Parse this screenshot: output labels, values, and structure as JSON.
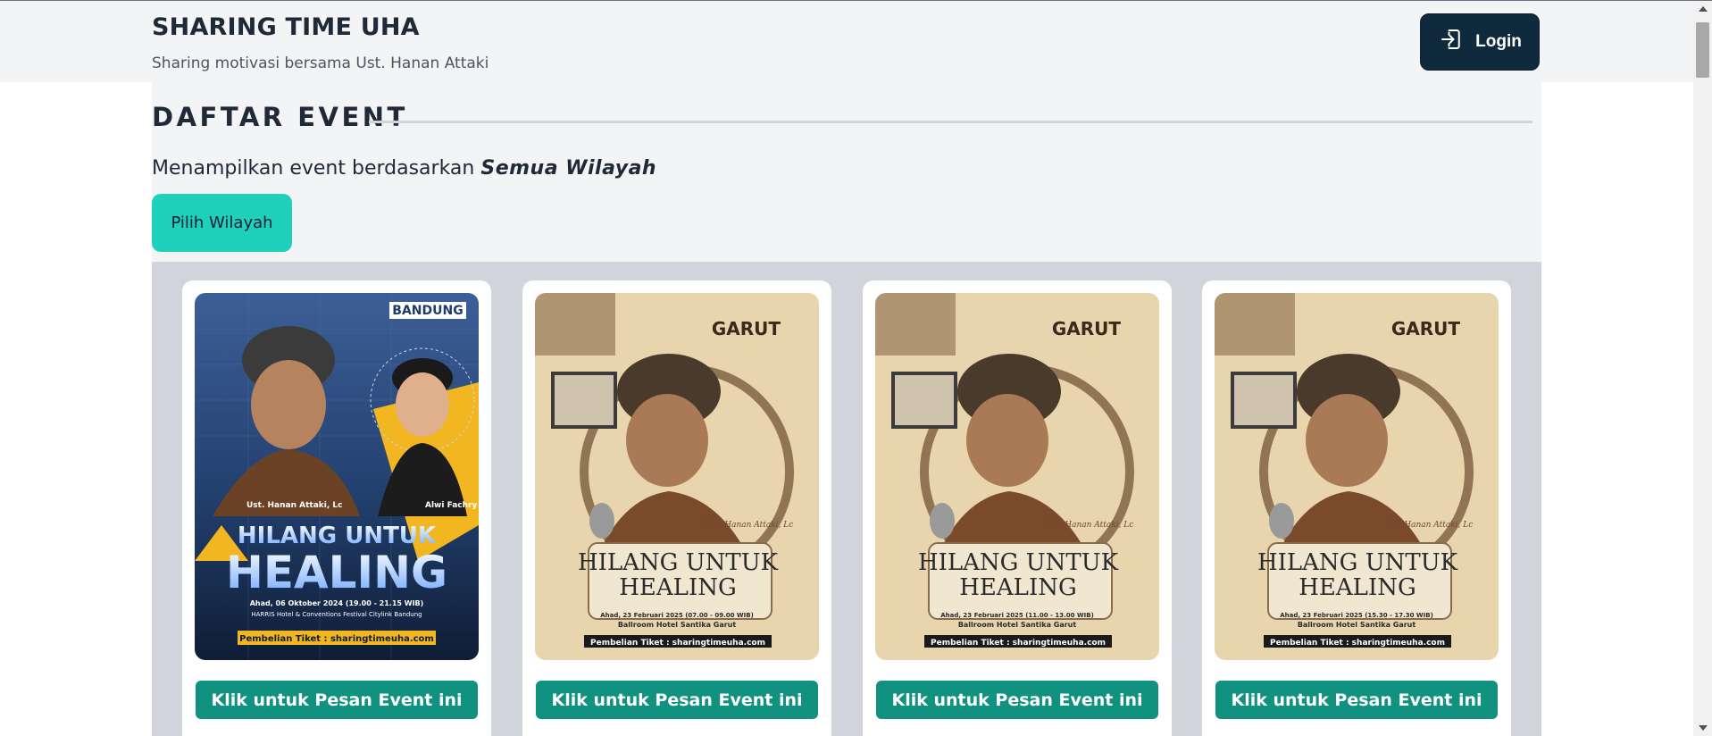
{
  "header": {
    "title": "SHARING TIME UHA",
    "subtitle": "Sharing motivasi bersama Ust. Hanan Attaki",
    "login_label": "Login"
  },
  "events_section": {
    "title": "DAFTAR EVENT",
    "filter_prefix": "Menampilkan event berdasarkan ",
    "filter_value": "Semua Wilayah",
    "choose_region_label": "Pilih Wilayah"
  },
  "colors": {
    "header_bg": "#f3f4f6",
    "login_bg": "#0f2a3d",
    "pilih_bg": "#1fd1bd",
    "order_btn_bg": "#11917f",
    "grid_bg": "#d1d5db"
  },
  "events": [
    {
      "city": "BANDUNG",
      "poster_headline_1": "HILANG UNTUK",
      "poster_headline_2": "HEALING",
      "poster_speaker": "Ust. Hanan Attaki, Lc",
      "poster_host": "Alwi Fachry",
      "poster_date": "Ahad, 06 Oktober 2024 (19.00 - 21.15 WIB)",
      "poster_venue": "HARRIS Hotel & Conventions Festival Citylink Bandung",
      "poster_ticket": "Pembelian Tiket : sharingtimeuha.com",
      "button_label": "Klik untuk Pesan Event ini"
    },
    {
      "city": "GARUT",
      "poster_headline_1": "HILANG UNTUK",
      "poster_headline_2": "HEALING",
      "poster_speaker": "Ust. Hanan Attaki, Lc",
      "poster_date": "Ahad, 23 Februari 2025 (07.00 - 09.00 WIB)",
      "poster_venue": "Ballroom Hotel Santika Garut",
      "poster_ticket": "Pembelian Tiket : sharingtimeuha.com",
      "button_label": "Klik untuk Pesan Event ini"
    },
    {
      "city": "GARUT",
      "poster_headline_1": "HILANG UNTUK",
      "poster_headline_2": "HEALING",
      "poster_speaker": "Ust. Hanan Attaki, Lc",
      "poster_date": "Ahad, 23 Februari 2025 (11.00 - 13.00 WIB)",
      "poster_venue": "Ballroom Hotel Santika Garut",
      "poster_ticket": "Pembelian Tiket : sharingtimeuha.com",
      "button_label": "Klik untuk Pesan Event ini"
    },
    {
      "city": "GARUT",
      "poster_headline_1": "HILANG UNTUK",
      "poster_headline_2": "HEALING",
      "poster_speaker": "Ust. Hanan Attaki, Lc",
      "poster_date": "Ahad, 23 Februari 2025 (15.30 - 17.30 WIB)",
      "poster_venue": "Ballroom Hotel Santika Garut",
      "poster_ticket": "Pembelian Tiket : sharingtimeuha.com",
      "button_label": "Klik untuk Pesan Event ini"
    }
  ]
}
